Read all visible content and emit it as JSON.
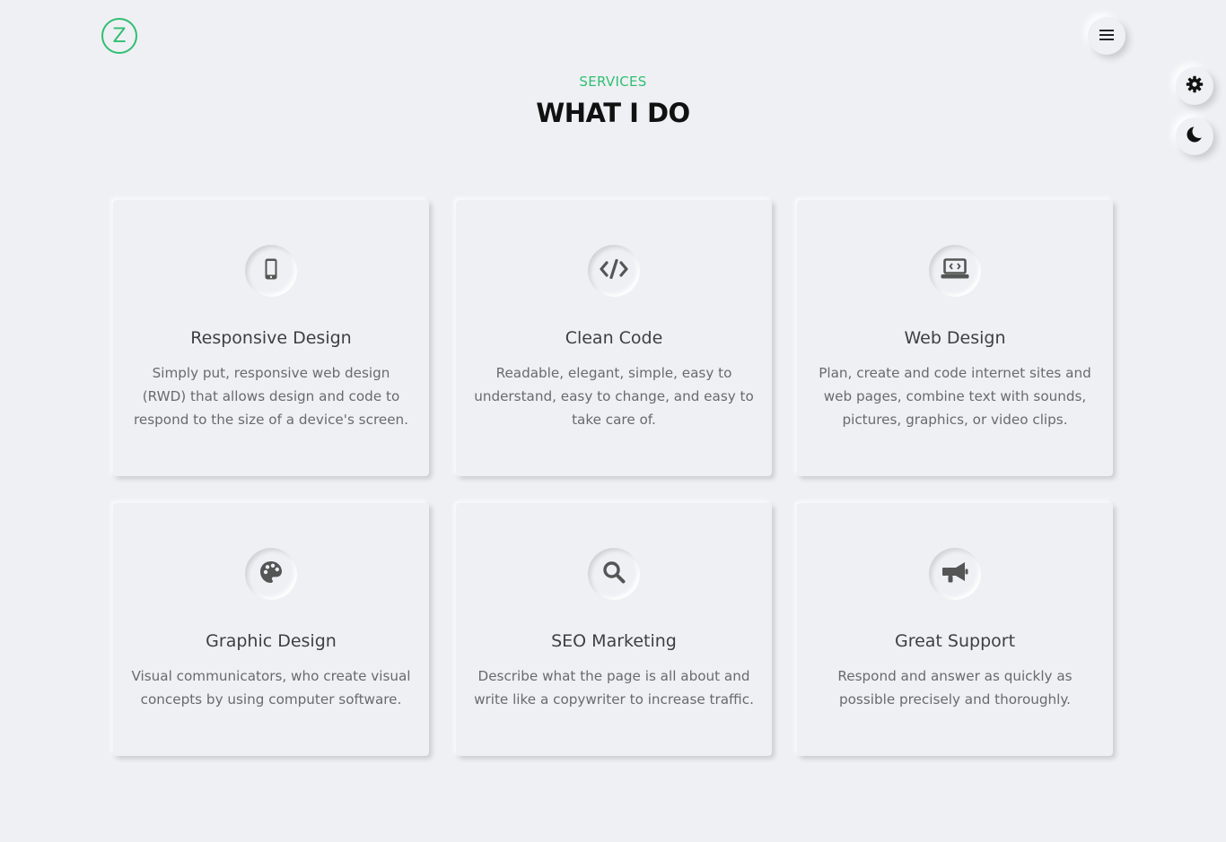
{
  "header": {
    "logo_letter": "Z",
    "menu_icon": "hamburger-menu-icon",
    "settings_icon": "gear-icon",
    "theme_icon": "moon-icon"
  },
  "section": {
    "eyebrow": "SERVICES",
    "title": "WHAT I DO"
  },
  "colors": {
    "accent": "#2fbf71",
    "background": "#eff0f4",
    "icon": "#555555"
  },
  "services": [
    {
      "icon": "mobile-phone-icon",
      "title": "Responsive Design",
      "text": "Simply put, responsive web design (RWD) that allows design and code to respond to the size of a device's screen."
    },
    {
      "icon": "code-icon",
      "title": "Clean Code",
      "text": "Readable, elegant, simple, easy to understand, easy to change, and easy to take care of."
    },
    {
      "icon": "laptop-code-icon",
      "title": "Web Design",
      "text": "Plan, create and code internet sites and web pages, combine text with sounds, pictures, graphics, or video clips."
    },
    {
      "icon": "palette-icon",
      "title": "Graphic Design",
      "text": "Visual communicators, who create visual concepts by using computer software."
    },
    {
      "icon": "search-icon",
      "title": "SEO Marketing",
      "text": "Describe what the page is all about and write like a copywriter to increase traffic."
    },
    {
      "icon": "megaphone-icon",
      "title": "Great Support",
      "text": "Respond and answer as quickly as possible precisely and thoroughly."
    }
  ]
}
